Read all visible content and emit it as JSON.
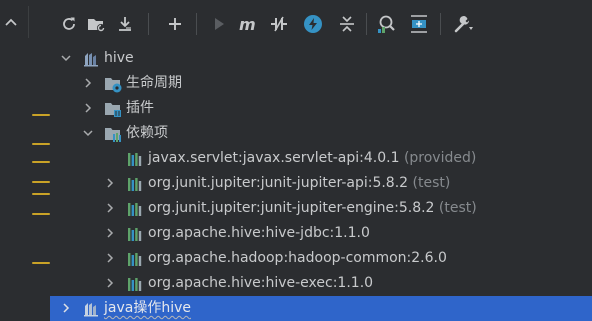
{
  "tree": {
    "root": {
      "label": "hive",
      "icon": "maven-module-icon"
    },
    "nodes": [
      {
        "label": "生命周期",
        "suffix": "",
        "icon": "lifecycle-folder-icon",
        "level": 1,
        "expand": "collapsed"
      },
      {
        "label": "插件",
        "suffix": "",
        "icon": "plugins-folder-icon",
        "level": 1,
        "expand": "collapsed"
      },
      {
        "label": "依赖项",
        "suffix": "",
        "icon": "dependencies-folder-icon",
        "level": 1,
        "expand": "expanded"
      },
      {
        "label": "javax.servlet:javax.servlet-api:4.0.1",
        "suffix": "(provided)",
        "icon": "library-icon",
        "level": 2,
        "expand": "none"
      },
      {
        "label": "org.junit.jupiter:junit-jupiter-api:5.8.2",
        "suffix": "(test)",
        "icon": "library-icon",
        "level": 2,
        "expand": "collapsed"
      },
      {
        "label": "org.junit.jupiter:junit-jupiter-engine:5.8.2",
        "suffix": "(test)",
        "icon": "library-icon",
        "level": 2,
        "expand": "collapsed"
      },
      {
        "label": "org.apache.hive:hive-jdbc:1.1.0",
        "suffix": "",
        "icon": "library-icon",
        "level": 2,
        "expand": "collapsed"
      },
      {
        "label": "org.apache.hadoop:hadoop-common:2.6.0",
        "suffix": "",
        "icon": "library-icon",
        "level": 2,
        "expand": "collapsed"
      },
      {
        "label": "org.apache.hive:hive-exec:1.1.0",
        "suffix": "",
        "icon": "library-icon",
        "level": 2,
        "expand": "collapsed"
      }
    ],
    "selected": {
      "label": "java操作hive",
      "icon": "maven-module-icon"
    }
  },
  "toolbar": {
    "buttons": [
      "reload-icon",
      "generate-sources-icon",
      "download-icon",
      "add-icon",
      "run-icon",
      "execute-goal-icon",
      "toggle-offline-icon",
      "skip-tests-icon",
      "collapse-icon",
      "analyze-dependencies-icon",
      "show-dependencies-icon",
      "settings-icon"
    ]
  },
  "colors": {
    "background": "#2b2d30",
    "selection": "#2f65ca",
    "text": "#c8cacc",
    "muted": "#868a8e",
    "accent_blue": "#3592c4",
    "library_green": "#5ea36a"
  }
}
